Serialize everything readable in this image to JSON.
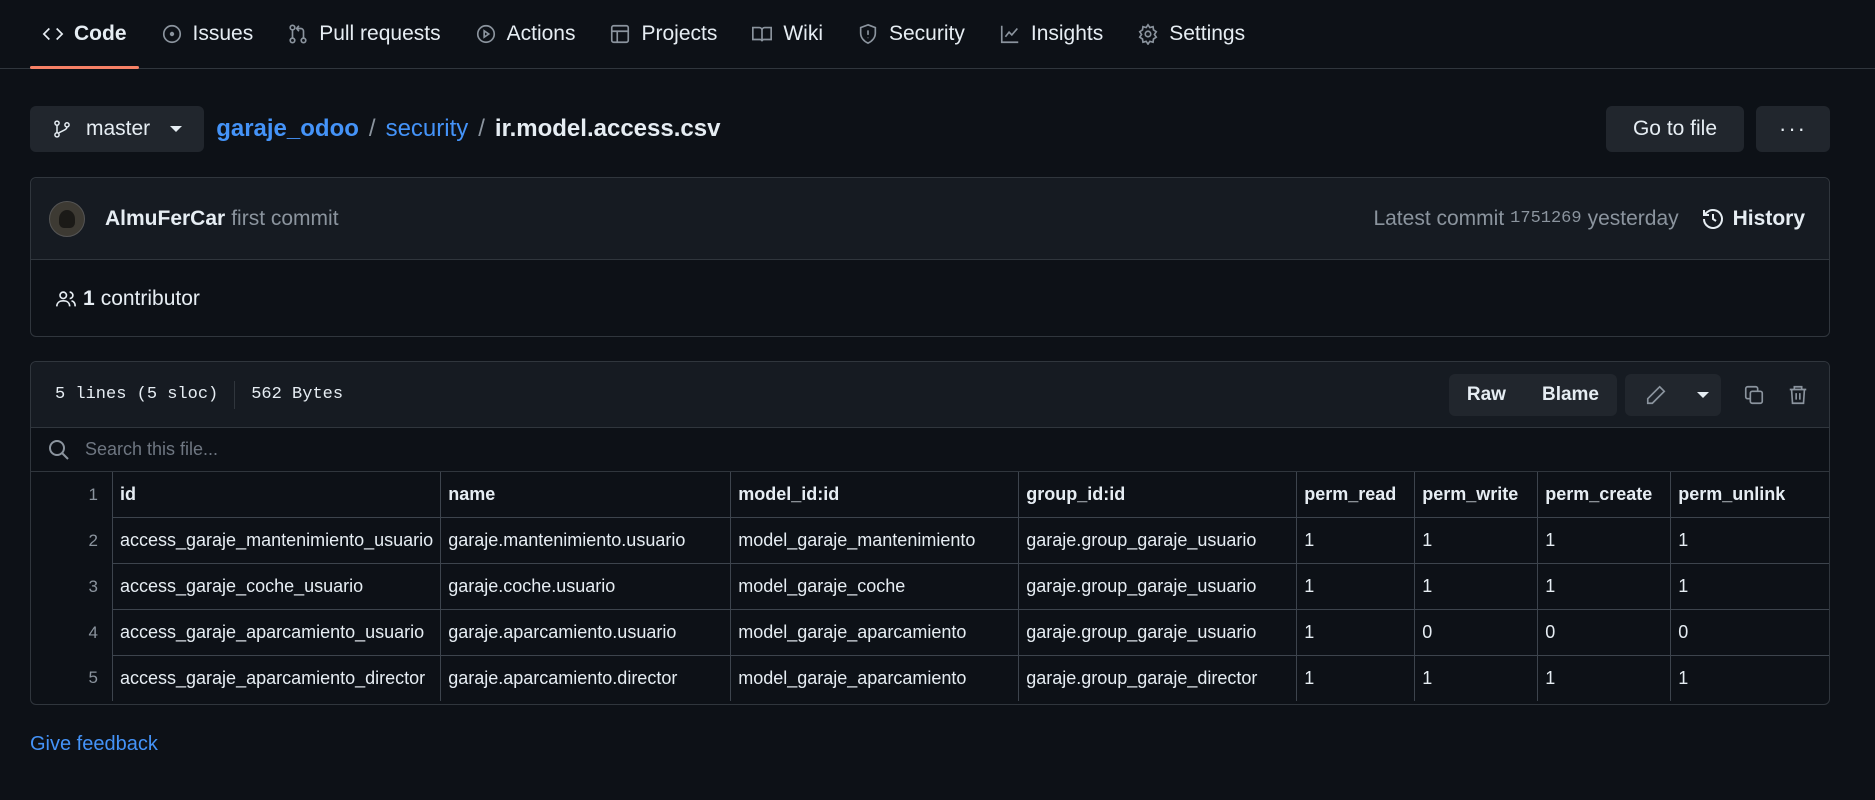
{
  "nav": {
    "items": [
      {
        "label": "Code",
        "icon": "code-icon",
        "active": true
      },
      {
        "label": "Issues",
        "icon": "issue-icon"
      },
      {
        "label": "Pull requests",
        "icon": "pull-request-icon"
      },
      {
        "label": "Actions",
        "icon": "play-icon"
      },
      {
        "label": "Projects",
        "icon": "table-icon"
      },
      {
        "label": "Wiki",
        "icon": "book-icon"
      },
      {
        "label": "Security",
        "icon": "shield-icon"
      },
      {
        "label": "Insights",
        "icon": "graph-icon"
      },
      {
        "label": "Settings",
        "icon": "gear-icon"
      }
    ]
  },
  "path": {
    "branch": "master",
    "repo": "garaje_odoo",
    "folder": "security",
    "file": "ir.model.access.csv",
    "sep": "/",
    "goto_label": "Go to file",
    "more_label": "···"
  },
  "commit": {
    "author": "AlmuFerCar",
    "message": "first commit",
    "latest_label": "Latest commit",
    "sha": "1751269",
    "time": "yesterday",
    "history_label": "History",
    "contributor_count": "1",
    "contributor_label": "contributor"
  },
  "file": {
    "lines_info": "5 lines (5 sloc)",
    "size": "562 Bytes",
    "raw_label": "Raw",
    "blame_label": "Blame",
    "search_placeholder": "Search this file...",
    "header": {
      "line": "1",
      "cells": [
        "id",
        "name",
        "model_id:id",
        "group_id:id",
        "perm_read",
        "perm_write",
        "perm_create",
        "perm_unlink"
      ]
    },
    "rows": [
      {
        "line": "2",
        "cells": [
          "access_garaje_mantenimiento_usuario",
          "garaje.mantenimiento.usuario",
          "model_garaje_mantenimiento",
          "garaje.group_garaje_usuario",
          "1",
          "1",
          "1",
          "1"
        ]
      },
      {
        "line": "3",
        "cells": [
          "access_garaje_coche_usuario",
          "garaje.coche.usuario",
          "model_garaje_coche",
          "garaje.group_garaje_usuario",
          "1",
          "1",
          "1",
          "1"
        ]
      },
      {
        "line": "4",
        "cells": [
          "access_garaje_aparcamiento_usuario",
          "garaje.aparcamiento.usuario",
          "model_garaje_aparcamiento",
          "garaje.group_garaje_usuario",
          "1",
          "0",
          "0",
          "0"
        ]
      },
      {
        "line": "5",
        "cells": [
          "access_garaje_aparcamiento_director",
          "garaje.aparcamiento.director",
          "model_garaje_aparcamiento",
          "garaje.group_garaje_director",
          "1",
          "1",
          "1",
          "1"
        ]
      }
    ]
  },
  "feedback_label": "Give feedback",
  "colors": {
    "accent": "#4493f8",
    "active_underline": "#f78166",
    "background": "#0d1117"
  }
}
